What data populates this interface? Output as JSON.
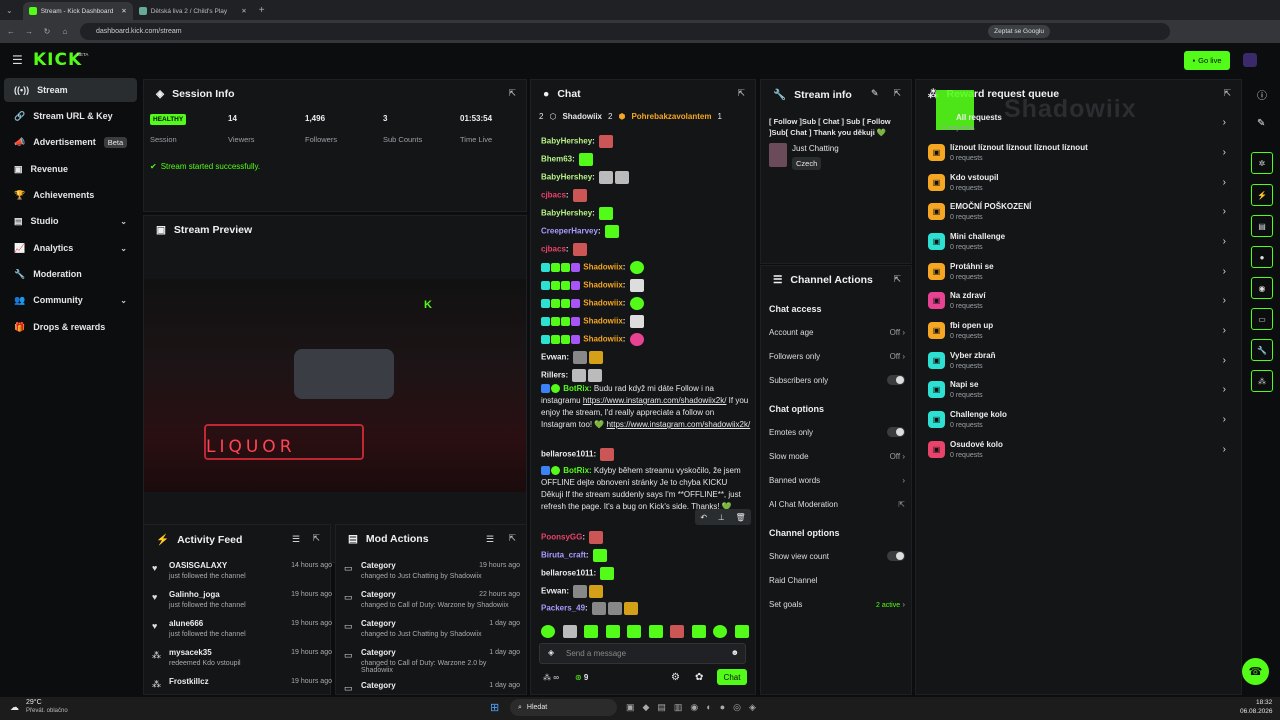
{
  "browser": {
    "tabs": [
      {
        "title": "Stream - Kick Dashboard",
        "active": true
      },
      {
        "title": "Dětská liva 2 / Child's Play",
        "active": false
      }
    ],
    "url": "dashboard.kick.com/stream",
    "google_label": "Zeptat se Googlu"
  },
  "brand": {
    "logo": "KICK",
    "beta": "BETA",
    "go_live": "Go live",
    "accent": "#53fc18"
  },
  "sidebar": {
    "items": [
      {
        "label": "Stream",
        "icon": "broadcast-icon"
      },
      {
        "label": "Stream URL & Key",
        "icon": "link-icon"
      },
      {
        "label": "Advertisement",
        "icon": "megaphone-icon",
        "badge": "Beta"
      },
      {
        "label": "Revenue",
        "icon": "revenue-icon"
      },
      {
        "label": "Achievements",
        "icon": "trophy-icon"
      },
      {
        "label": "Studio",
        "icon": "studio-icon"
      },
      {
        "label": "Analytics",
        "icon": "chart-icon"
      },
      {
        "label": "Moderation",
        "icon": "wrench-icon"
      },
      {
        "label": "Community",
        "icon": "people-icon"
      },
      {
        "label": "Drops & rewards",
        "icon": "gift-icon"
      }
    ]
  },
  "session": {
    "title": "Session Info",
    "health": "HEALTHY",
    "health_label": "Session",
    "stats": [
      {
        "value": "14",
        "label": "Viewers"
      },
      {
        "value": "1,496",
        "label": "Followers"
      },
      {
        "value": "3",
        "label": "Sub Counts"
      },
      {
        "value": "01:53:54",
        "label": "Time Live"
      }
    ],
    "status": "Stream started successfully."
  },
  "preview": {
    "title": "Stream Preview",
    "sign_text": "LIQUOR"
  },
  "chat": {
    "title": "Chat",
    "pinned": {
      "count": "2",
      "user1": "Shadowiix",
      "user1_count": "2",
      "user2": "Pohrebakzavolantem",
      "user2_count": "1"
    },
    "lines": [
      {
        "user": "BabyHershey",
        "color": "#b6f285"
      },
      {
        "user": "Bhem63",
        "color": "#b6f285"
      },
      {
        "user": "BabyHershey",
        "color": "#b6f285"
      },
      {
        "user": "cjbacs",
        "color": "#e8436a"
      },
      {
        "user": "BabyHershey",
        "color": "#b6f285"
      },
      {
        "user": "CreeperHarvey",
        "color": "#a69bff"
      },
      {
        "user": "cjbacs",
        "color": "#e8436a"
      },
      {
        "user": "Shadowiix",
        "color": "#f5a623"
      },
      {
        "user": "Shadowiix",
        "color": "#f5a623"
      },
      {
        "user": "Shadowiix",
        "color": "#f5a623"
      },
      {
        "user": "Shadowiix",
        "color": "#f5a623"
      },
      {
        "user": "Shadowiix",
        "color": "#f5a623"
      },
      {
        "user": "Evwan",
        "color": "#eeeeee"
      },
      {
        "user": "Rillers",
        "color": "#eeeeee"
      }
    ],
    "bot1_user": "BotRix",
    "bot1_text": "Budu rad když mi dáte Follow i na instagramu",
    "bot1_link": "https://www.instagram.com/shadowiix2k/",
    "bot1_text2": "If you enjoy the stream, I'd really appreciate a follow on Instagram too! 💚",
    "bot1_link2": "https://www.instagram.com/shadowiix2k/",
    "bellarose": "bellarose1011",
    "bot2_user": "BotRix",
    "bot2_text": "Kdyby během streamu vyskočilo, že jsem OFFLINE dejte obnovení stránky Je to chyba KICKU Děkuji If the stream suddenly says I'm **OFFLINE**, just refresh the page. It's a bug on Kick's side. Thanks! 💚",
    "lines2": [
      {
        "user": "PoonsyGG",
        "color": "#e8436a"
      },
      {
        "user": "Biruta_craft",
        "color": "#a69bff"
      },
      {
        "user": "bellarose1011",
        "color": "#eeeeee"
      },
      {
        "user": "Evwan",
        "color": "#eeeeee"
      },
      {
        "user": "Packers_49",
        "color": "#a69bff"
      }
    ],
    "input_placeholder": "Send a message",
    "viewers": "∞",
    "points": "9",
    "send_label": "Chat"
  },
  "stream_info": {
    "title": "Stream info",
    "stream_title": "[ Follow ]Sub [ Chat ] Sub [ Follow ]Sub[ Chat ] Thank you děkuji 💚",
    "category": "Just Chatting",
    "language": "Czech"
  },
  "channel_actions": {
    "title": "Channel Actions",
    "chat_access": "Chat access",
    "account_age": "Account age",
    "account_age_val": "Off",
    "followers_only": "Followers only",
    "followers_only_val": "Off",
    "subscribers_only": "Subscribers only",
    "chat_options": "Chat options",
    "emotes_only": "Emotes only",
    "slow_mode": "Slow mode",
    "slow_mode_val": "Off",
    "banned_words": "Banned words",
    "ai_moderation": "AI Chat Moderation",
    "channel_options": "Channel options",
    "show_view_count": "Show view count",
    "raid_channel": "Raid Channel",
    "set_goals": "Set goals",
    "set_goals_val": "2 active"
  },
  "reward_queue": {
    "title": "Reward request queue",
    "overlay_text": "Shadowiix",
    "first_item": "All requests",
    "first_sub": "0 requests",
    "items": [
      {
        "name": "líznout líznout líznout líznout líznout",
        "sub": "0 requests",
        "color": "#f5a623"
      },
      {
        "name": "Kdo vstoupil",
        "sub": "0 requests",
        "color": "#f5a623"
      },
      {
        "name": "EMOČNÍ POŠKOZENÍ",
        "sub": "0 requests",
        "color": "#f5a623"
      },
      {
        "name": "Mini challenge",
        "sub": "0 requests",
        "color": "#2ee0d1"
      },
      {
        "name": "Protáhni se",
        "sub": "0 requests",
        "color": "#f5a623"
      },
      {
        "name": "Na zdraví",
        "sub": "0 requests",
        "color": "#e84393"
      },
      {
        "name": "fbi open up",
        "sub": "0 requests",
        "color": "#f5a623"
      },
      {
        "name": "Vyber zbraň",
        "sub": "0 requests",
        "color": "#2ee0d1"
      },
      {
        "name": "Napi se",
        "sub": "0 requests",
        "color": "#2ee0d1"
      },
      {
        "name": "Challenge kolo",
        "sub": "0 requests",
        "color": "#2ee0d1"
      },
      {
        "name": "Osudové kolo",
        "sub": "0 requests",
        "color": "#e8436a"
      }
    ]
  },
  "activity": {
    "title": "Activity Feed",
    "items": [
      {
        "name": "OASISGALAXY",
        "text": "just followed the channel",
        "time": "14 hours ago"
      },
      {
        "name": "Galinho_joga",
        "text": "just followed the channel",
        "time": "19 hours ago"
      },
      {
        "name": "alune666",
        "text": "just followed the channel",
        "time": "19 hours ago"
      },
      {
        "name": "mysacek35",
        "text": "redeemed Kdo vstoupil",
        "time": "19 hours ago"
      },
      {
        "name": "Frostkillcz",
        "text": "",
        "time": "19 hours ago"
      }
    ]
  },
  "mod_actions": {
    "title": "Mod Actions",
    "items": [
      {
        "name": "Category",
        "text": "changed to Just Chatting by Shadowiix",
        "time": "19 hours ago"
      },
      {
        "name": "Category",
        "text": "changed to Call of Duty: Warzone by Shadowiix",
        "time": "22 hours ago"
      },
      {
        "name": "Category",
        "text": "changed to Just Chatting by Shadowiix",
        "time": "1 day ago"
      },
      {
        "name": "Category",
        "text": "changed to Call of Duty: Warzone 2.0 by Shadowiix",
        "time": "1 day ago"
      },
      {
        "name": "Category",
        "text": "",
        "time": "1 day ago"
      }
    ]
  },
  "taskbar": {
    "weather": "29°C",
    "weather_sub": "Převát. oblačno",
    "search": "Hledat",
    "time": "18:32",
    "date": "06.08.2026"
  }
}
